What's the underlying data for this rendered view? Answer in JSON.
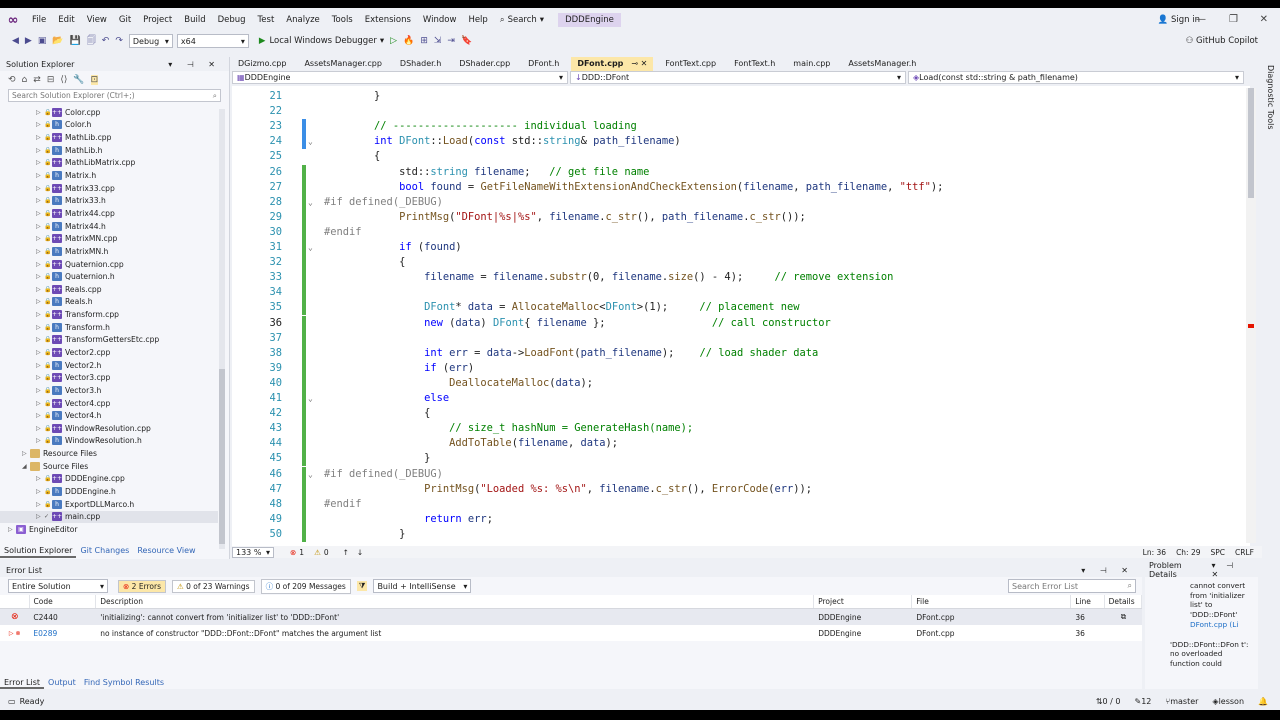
{
  "menu": [
    "File",
    "Edit",
    "View",
    "Git",
    "Project",
    "Build",
    "Debug",
    "Test",
    "Analyze",
    "Tools",
    "Extensions",
    "Window",
    "Help"
  ],
  "search_label": "Search",
  "solution_name": "DDDEngine",
  "signin": "Sign in",
  "copilot": "GitHub Copilot",
  "toolbar": {
    "config": "Debug",
    "platform": "x64",
    "run": "Local Windows Debugger"
  },
  "solution_explorer": {
    "title": "Solution Explorer",
    "search_placeholder": "Search Solution Explorer (Ctrl+;)",
    "items": [
      {
        "label": "Color.cpp",
        "type": "cpp"
      },
      {
        "label": "Color.h",
        "type": "h"
      },
      {
        "label": "MathLib.cpp",
        "type": "cpp"
      },
      {
        "label": "MathLib.h",
        "type": "h"
      },
      {
        "label": "MathLibMatrix.cpp",
        "type": "cpp"
      },
      {
        "label": "Matrix.h",
        "type": "h"
      },
      {
        "label": "Matrix33.cpp",
        "type": "cpp"
      },
      {
        "label": "Matrix33.h",
        "type": "h"
      },
      {
        "label": "Matrix44.cpp",
        "type": "cpp"
      },
      {
        "label": "Matrix44.h",
        "type": "h"
      },
      {
        "label": "MatrixMN.cpp",
        "type": "cpp"
      },
      {
        "label": "MatrixMN.h",
        "type": "h"
      },
      {
        "label": "Quaternion.cpp",
        "type": "cpp"
      },
      {
        "label": "Quaternion.h",
        "type": "h"
      },
      {
        "label": "Reals.cpp",
        "type": "cpp"
      },
      {
        "label": "Reals.h",
        "type": "h"
      },
      {
        "label": "Transform.cpp",
        "type": "cpp"
      },
      {
        "label": "Transform.h",
        "type": "h"
      },
      {
        "label": "TransformGettersEtc.cpp",
        "type": "cpp"
      },
      {
        "label": "Vector2.cpp",
        "type": "cpp"
      },
      {
        "label": "Vector2.h",
        "type": "h"
      },
      {
        "label": "Vector3.cpp",
        "type": "cpp"
      },
      {
        "label": "Vector3.h",
        "type": "h"
      },
      {
        "label": "Vector4.cpp",
        "type": "cpp"
      },
      {
        "label": "Vector4.h",
        "type": "h"
      },
      {
        "label": "WindowResolution.cpp",
        "type": "cpp"
      },
      {
        "label": "WindowResolution.h",
        "type": "h"
      },
      {
        "label": "Resource Files",
        "type": "fld"
      },
      {
        "label": "Source Files",
        "type": "fld"
      },
      {
        "label": "DDDEngine.cpp",
        "type": "cpp"
      },
      {
        "label": "DDDEngine.h",
        "type": "h"
      },
      {
        "label": "ExportDLLMarco.h",
        "type": "h"
      },
      {
        "label": "main.cpp",
        "type": "cpp"
      },
      {
        "label": "EngineEditor",
        "type": "proj"
      }
    ],
    "tabs": [
      "Solution Explorer",
      "Git Changes",
      "Resource View"
    ]
  },
  "tabs": [
    "DGizmo.cpp",
    "AssetsManager.cpp",
    "DShader.h",
    "DShader.cpp",
    "DFont.h",
    "DFont.cpp",
    "FontText.cpp",
    "FontText.h",
    "main.cpp",
    "AssetsManager.h"
  ],
  "active_tab": "DFont.cpp",
  "nav": {
    "project": "DDDEngine",
    "scope": "DDD::DFont",
    "member": "Load(const std::string & path_filename)"
  },
  "code_lines": [
    {
      "n": "21",
      "t": "        }"
    },
    {
      "n": "22",
      "t": ""
    },
    {
      "n": "23",
      "t": "        // -------------------- individual loading"
    },
    {
      "n": "24",
      "t": "        int DFont::Load(const std::string& path_filename)"
    },
    {
      "n": "25",
      "t": "        {"
    },
    {
      "n": "26",
      "t": "            std::string filename;   // get file name"
    },
    {
      "n": "27",
      "t": "            bool found = GetFileNameWithExtensionAndCheckExtension(filename, path_filename, \"ttf\");"
    },
    {
      "n": "28",
      "t": "#if defined(_DEBUG)"
    },
    {
      "n": "29",
      "t": "            PrintMsg(\"DFont|%s|%s\", filename.c_str(), path_filename.c_str());"
    },
    {
      "n": "30",
      "t": "#endif"
    },
    {
      "n": "31",
      "t": "            if (found)"
    },
    {
      "n": "32",
      "t": "            {"
    },
    {
      "n": "33",
      "t": "                filename = filename.substr(0, filename.size() - 4);     // remove extension"
    },
    {
      "n": "34",
      "t": ""
    },
    {
      "n": "35",
      "t": "                DFont* data = AllocateMalloc<DFont>(1);     // placement new"
    },
    {
      "n": "36",
      "t": "                new (data) DFont{ filename };                 // call constructor"
    },
    {
      "n": "37",
      "t": ""
    },
    {
      "n": "38",
      "t": "                int err = data->LoadFont(path_filename);    // load shader data"
    },
    {
      "n": "39",
      "t": "                if (err)"
    },
    {
      "n": "40",
      "t": "                    DeallocateMalloc(data);"
    },
    {
      "n": "41",
      "t": "                else"
    },
    {
      "n": "42",
      "t": "                {"
    },
    {
      "n": "43",
      "t": "                    // size_t hashNum = GenerateHash(name);"
    },
    {
      "n": "44",
      "t": "                    AddToTable(filename, data);"
    },
    {
      "n": "45",
      "t": "                }"
    },
    {
      "n": "46",
      "t": "#if defined(_DEBUG)"
    },
    {
      "n": "47",
      "t": "                PrintMsg(\"Loaded %s: %s\\n\", filename.c_str(), ErrorCode(err));"
    },
    {
      "n": "48",
      "t": "#endif"
    },
    {
      "n": "49",
      "t": "                return err;"
    },
    {
      "n": "50",
      "t": "            }"
    }
  ],
  "editor_status": {
    "zoom": "133 %",
    "errors": "1",
    "warnings": "0",
    "pos": "Ln: 36",
    "col": "Ch: 29",
    "spc": "SPC",
    "crlf": "CRLF"
  },
  "error_list": {
    "title": "Error List",
    "scope": "Entire Solution",
    "errors_badge": "2 Errors",
    "warnings_badge": "0 of 23 Warnings",
    "messages_badge": "0 of 209 Messages",
    "build_filter": "Build + IntelliSense",
    "search_placeholder": "Search Error List",
    "columns": [
      "Code",
      "Description",
      "Project",
      "File",
      "Line",
      "Details"
    ],
    "rows": [
      {
        "code": "C2440",
        "desc": "'initializing': cannot convert from 'initializer list' to 'DDD::DFont'",
        "project": "DDDEngine",
        "file": "DFont.cpp",
        "line": "36"
      },
      {
        "code": "E0289",
        "desc": "no instance of constructor \"DDD::DFont::DFont\" matches the argument list",
        "project": "DDDEngine",
        "file": "DFont.cpp",
        "line": "36"
      }
    ],
    "tabs": [
      "Error List",
      "Output",
      "Find Symbol Results"
    ]
  },
  "problem_details": {
    "title": "Problem Details",
    "text1": "cannot convert from 'initializer list' to 'DDD::DFont'",
    "link": "DFont.cpp (Li",
    "text2": "'DDD::DFont::DFon t': no overloaded function could"
  },
  "statusbar": {
    "ready": "Ready",
    "updown": "0 / 0",
    "pencil": "12",
    "branch": "master",
    "repo": "lesson"
  },
  "right_rail": "Diagnostic Tools"
}
